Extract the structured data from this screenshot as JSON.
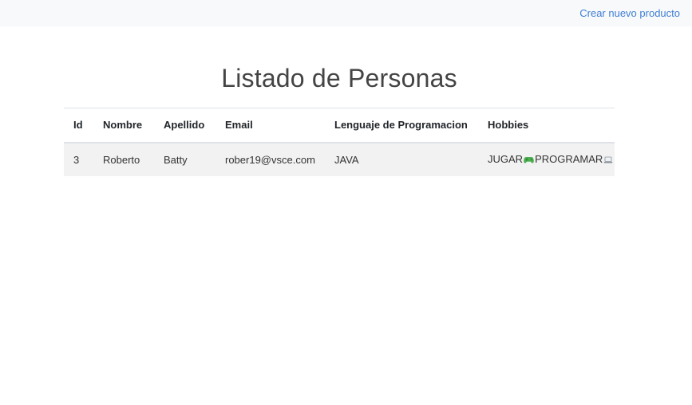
{
  "navbar": {
    "create_link": "Crear nuevo producto"
  },
  "page": {
    "title": "Listado de Personas"
  },
  "table": {
    "headers": [
      "Id",
      "Nombre",
      "Apellido",
      "Email",
      "Lenguaje de Programacion",
      "Hobbies"
    ],
    "rows": [
      {
        "id": "3",
        "nombre": "Roberto",
        "apellido": "Batty",
        "email": "rober19@vsce.com",
        "lenguaje": "JAVA",
        "hobbies": [
          {
            "text": "JUGAR",
            "icon": "gamepad-icon"
          },
          {
            "text": "PROGRAMAR",
            "icon": "laptop-icon"
          }
        ]
      }
    ]
  },
  "colors": {
    "navbar_bg": "#f8f9fa",
    "link": "#3f7fd6",
    "row_bg": "#f2f2f2",
    "gamepad_icon": "#4caf50"
  }
}
